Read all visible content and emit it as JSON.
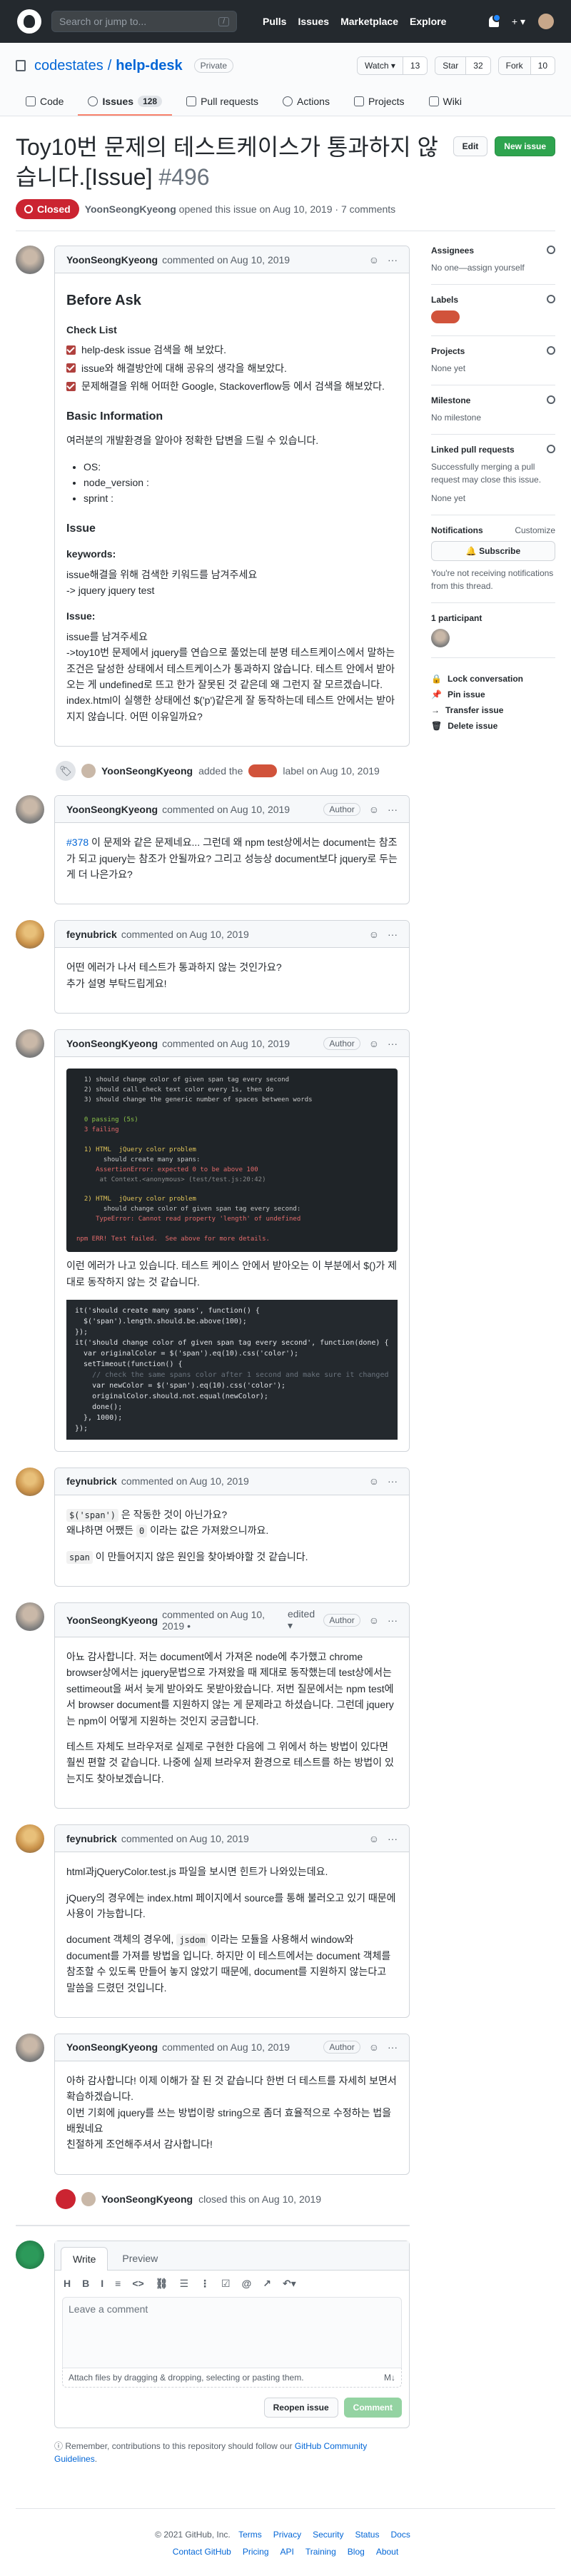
{
  "topbar": {
    "search_placeholder": "Search or jump to...",
    "search_key": "/",
    "nav": [
      "Pulls",
      "Issues",
      "Marketplace",
      "Explore"
    ],
    "plus": "+ ▾"
  },
  "repo": {
    "owner": "codestates",
    "name": "help-desk",
    "visibility": "Private",
    "watch": "Watch ▾",
    "watch_count": "13",
    "star": "Star",
    "star_count": "32",
    "fork": "Fork",
    "fork_count": "10"
  },
  "tabs": [
    {
      "label": "Code"
    },
    {
      "label": "Issues",
      "count": "128"
    },
    {
      "label": "Pull requests"
    },
    {
      "label": "Actions"
    },
    {
      "label": "Projects"
    },
    {
      "label": "Wiki"
    }
  ],
  "issue": {
    "title": "Toy10번 문제의 테스트케이스가 통과하지 않습니다.[Issue]",
    "number": "#496",
    "edit": "Edit",
    "new_issue": "New issue",
    "state": "Closed",
    "author": "YoonSeongKyeong",
    "meta": "opened this issue on Aug 10, 2019 · 7 comments"
  },
  "comments": [
    {
      "author": "YoonSeongKyeong",
      "date": "commented on Aug 10, 2019",
      "before_ask": "Before Ask",
      "checklist_title": "Check List",
      "checklist": [
        "help-desk issue 검색을 해 보았다.",
        "issue와 해결방안에 대해 공유의 생각을 해보았다.",
        "문제해결을 위해 어떠한 Google, Stackoverflow등 에서 검색을 해보았다."
      ],
      "basic_info": "Basic Information",
      "basic_desc": "여러분의 개발환경을 알아야 정확한 답변을 드릴 수 있습니다.",
      "basic_list": [
        "OS:",
        "node_version :",
        "sprint :"
      ],
      "issue_h": "Issue",
      "keywords_h": "keywords:",
      "keywords_text": "issue해결을 위해 검색한 키워드를 남겨주세요",
      "keywords_val": "-> jquery jquery test",
      "issue_sub": "Issue:",
      "issue_text1": "issue를 남겨주세요",
      "issue_text2": "->toy10번 문제에서 jquery를 연습으로 풀었는데 분명 테스트케이스에서 말하는 조건은 달성한 상태에서 테스트케이스가 통과하지 않습니다. 테스트 안에서 받아오는 게 undefined로 뜨고 한가 잘못된 것 같은데 왜 그런지 잘 모르겠습니다. index.html이 실행한 상태에선 $('p')같은게 잘 동작하는데 테스트 안에서는 받아지지 않습니다. 어떤 이유일까요?"
    },
    {
      "author": "YoonSeongKyeong",
      "date": "commented on Aug 10, 2019",
      "badge": "Author",
      "link": "#378",
      "text": "이 문제와 같은 문제네요... 그런데 왜 npm test상에서는 document는 참조가 되고 jquery는 참조가 안될까요? 그리고 성능상 document보다 jquery로 두는 게 더 나은가요?"
    },
    {
      "author": "feynubrick",
      "date": "commented on Aug 10, 2019",
      "text1": "어떤 에러가 나서 테스트가 통과하지 않는 것인가요?",
      "text2": "추가 설명 부탁드립게요!"
    },
    {
      "author": "YoonSeongKyeong",
      "date": "commented on Aug 10, 2019",
      "badge": "Author",
      "term_lines": [
        "  1) should change color of given span tag every second",
        "  2) should call check text color every 1s, then do",
        "  3) should change the generic number of spaces between words",
        "",
        "  0 passing (5s)",
        "  3 failing",
        "",
        "  1) HTML  jQuery color problem",
        "       should create many spans:",
        "     AssertionError: expected 0 to be above 100",
        "      at Context.<anonymous> (test/test.js:20:42)",
        "",
        "  2) HTML  jQuery color problem",
        "       should change color of given span tag every second:",
        "     TypeError: Cannot read property 'length' of undefined",
        "",
        "npm ERR! Test failed.  See above for more details."
      ],
      "text": "이런 에러가 나고 있습니다. 테스트 케이스 안에서 받아오는 이 부분에서 $()가 제대로 동작하지 않는 것 같습니다.",
      "code_lines": [
        "it('should create many spans', function() {",
        "  $('span').length.should.be.above(100);",
        "});",
        "it('should change color of given span tag every second', function(done) {",
        "  var originalColor = $('span').eq(10).css('color');",
        "  setTimeout(function() {",
        "    // check the same spans color after 1 second and make sure it changed",
        "    var newColor = $('span').eq(10).css('color');",
        "    originalColor.should.not.equal(newColor);",
        "    done();",
        "  }, 1000);",
        "});"
      ]
    },
    {
      "author": "feynubrick",
      "date": "commented on Aug 10, 2019",
      "code1": "$('span')",
      "text1": "은 작동한 것이 아닌가요?",
      "text2a": "왜냐하면 어쨌든",
      "code2": "0",
      "text2b": "이라는 값은 가져왔으니까요.",
      "code3": "span",
      "text3": "이 만들어지지 않은 원인을 찾아봐야할 것 같습니다."
    },
    {
      "author": "YoonSeongKyeong",
      "date": "commented on Aug 10, 2019 •",
      "edited": "edited ▾",
      "badge": "Author",
      "text1": "아뇨 감사합니다. 저는 document에서 가져온 node에 추가했고 chrome browser상에서는 jquery문법으로 가져왔을 때 제대로 동작했는데 test상에서는 settimeout을 써서 늦게 받아와도 못받아왔습니다. 저번 질문에서는 npm test에서 browser document를 지원하지 않는 게 문제라고 하셨습니다. 그런데 jquery는 npm이 어떻게 지원하는 것인지 궁금합니다.",
      "text2": "테스트 자체도 브라우저로 실제로 구현한 다음에 그 위에서 하는 방법이 있다면 훨씬 편할 것 같습니다. 나중에 실제 브라우저 환경으로 테스트를 하는 방법이 있는지도 찾아보겠습니다."
    },
    {
      "author": "feynubrick",
      "date": "commented on Aug 10, 2019",
      "text1": "html과jQueryColor.test.js 파일을 보시면 힌트가 나와있는데요.",
      "text2": "jQuery의 경우에는 index.html 페이지에서 source를 통해 불러오고 있기 때문에 사용이 가능합니다.",
      "text3a": "document 객체의 경우에,",
      "code3": "jsdom",
      "text3b": "이라는 모듈을 사용해서 window와 document를 가져를 방법을 입니다. 하지만 이 테스트에서는 document 객체를 참조할 수 있도록 만들어 놓지 않았기 때문에, document를 지원하지 않는다고 말씀을 드렸던 것입니다."
    },
    {
      "author": "YoonSeongKyeong",
      "date": "commented on Aug 10, 2019",
      "badge": "Author",
      "text1": "아하 감사합니다! 이제 이해가 잘 된 것 같습니다 한번 더 테스트를 자세히 보면서 확습하겠습니다.",
      "text2": "이번 기회에 jquery를 쓰는 방법이랑 string으로 좀더 효율적으로 수정하는 법을 배웠네요",
      "text3": "친절하게 조언해주셔서 감사합니다!"
    }
  ],
  "events": {
    "label_actor": "YoonSeongKyeong",
    "label_pre": "added the",
    "label_post": "label on Aug 10, 2019",
    "close_actor": "YoonSeongKyeong",
    "close_text": "closed this on Aug 10, 2019"
  },
  "sidebar": {
    "assignees_h": "Assignees",
    "assignees_v": "No one—assign yourself",
    "labels_h": "Labels",
    "projects_h": "Projects",
    "projects_v": "None yet",
    "milestone_h": "Milestone",
    "milestone_v": "No milestone",
    "linked_h": "Linked pull requests",
    "linked_v": "Successfully merging a pull request may close this issue.",
    "linked_none": "None yet",
    "notif_h": "Notifications",
    "customize": "Customize",
    "subscribe": "Subscribe",
    "notif_v": "You're not receiving notifications from this thread.",
    "participants": "1 participant",
    "lock": "Lock conversation",
    "pin": "Pin issue",
    "transfer": "Transfer issue",
    "delete": "Delete issue"
  },
  "editor": {
    "write": "Write",
    "preview": "Preview",
    "toolbar": [
      "H",
      "B",
      "I",
      "≡",
      "<>",
      "⛓",
      "☰",
      "⋮",
      "☑",
      "@",
      "↗",
      "↶▾"
    ],
    "placeholder": "Leave a comment",
    "attach": "Attach files by dragging & dropping, selecting or pasting them.",
    "reopen": "Reopen issue",
    "comment": "Comment"
  },
  "notice": {
    "text": "Remember, contributions to this repository should follow our",
    "link": "GitHub Community Guidelines",
    "end": "."
  },
  "footer": {
    "copyright": "© 2021 GitHub, Inc.",
    "row1": [
      "Terms",
      "Privacy",
      "Security",
      "Status",
      "Docs"
    ],
    "row2": [
      "Contact GitHub",
      "Pricing",
      "API",
      "Training",
      "Blog",
      "About"
    ]
  },
  "colors": {
    "accent": "#0366d6",
    "closed": "#cb2431",
    "green": "#2ea44f",
    "label": "#d1533b",
    "tab_underline": "#f9826c"
  }
}
